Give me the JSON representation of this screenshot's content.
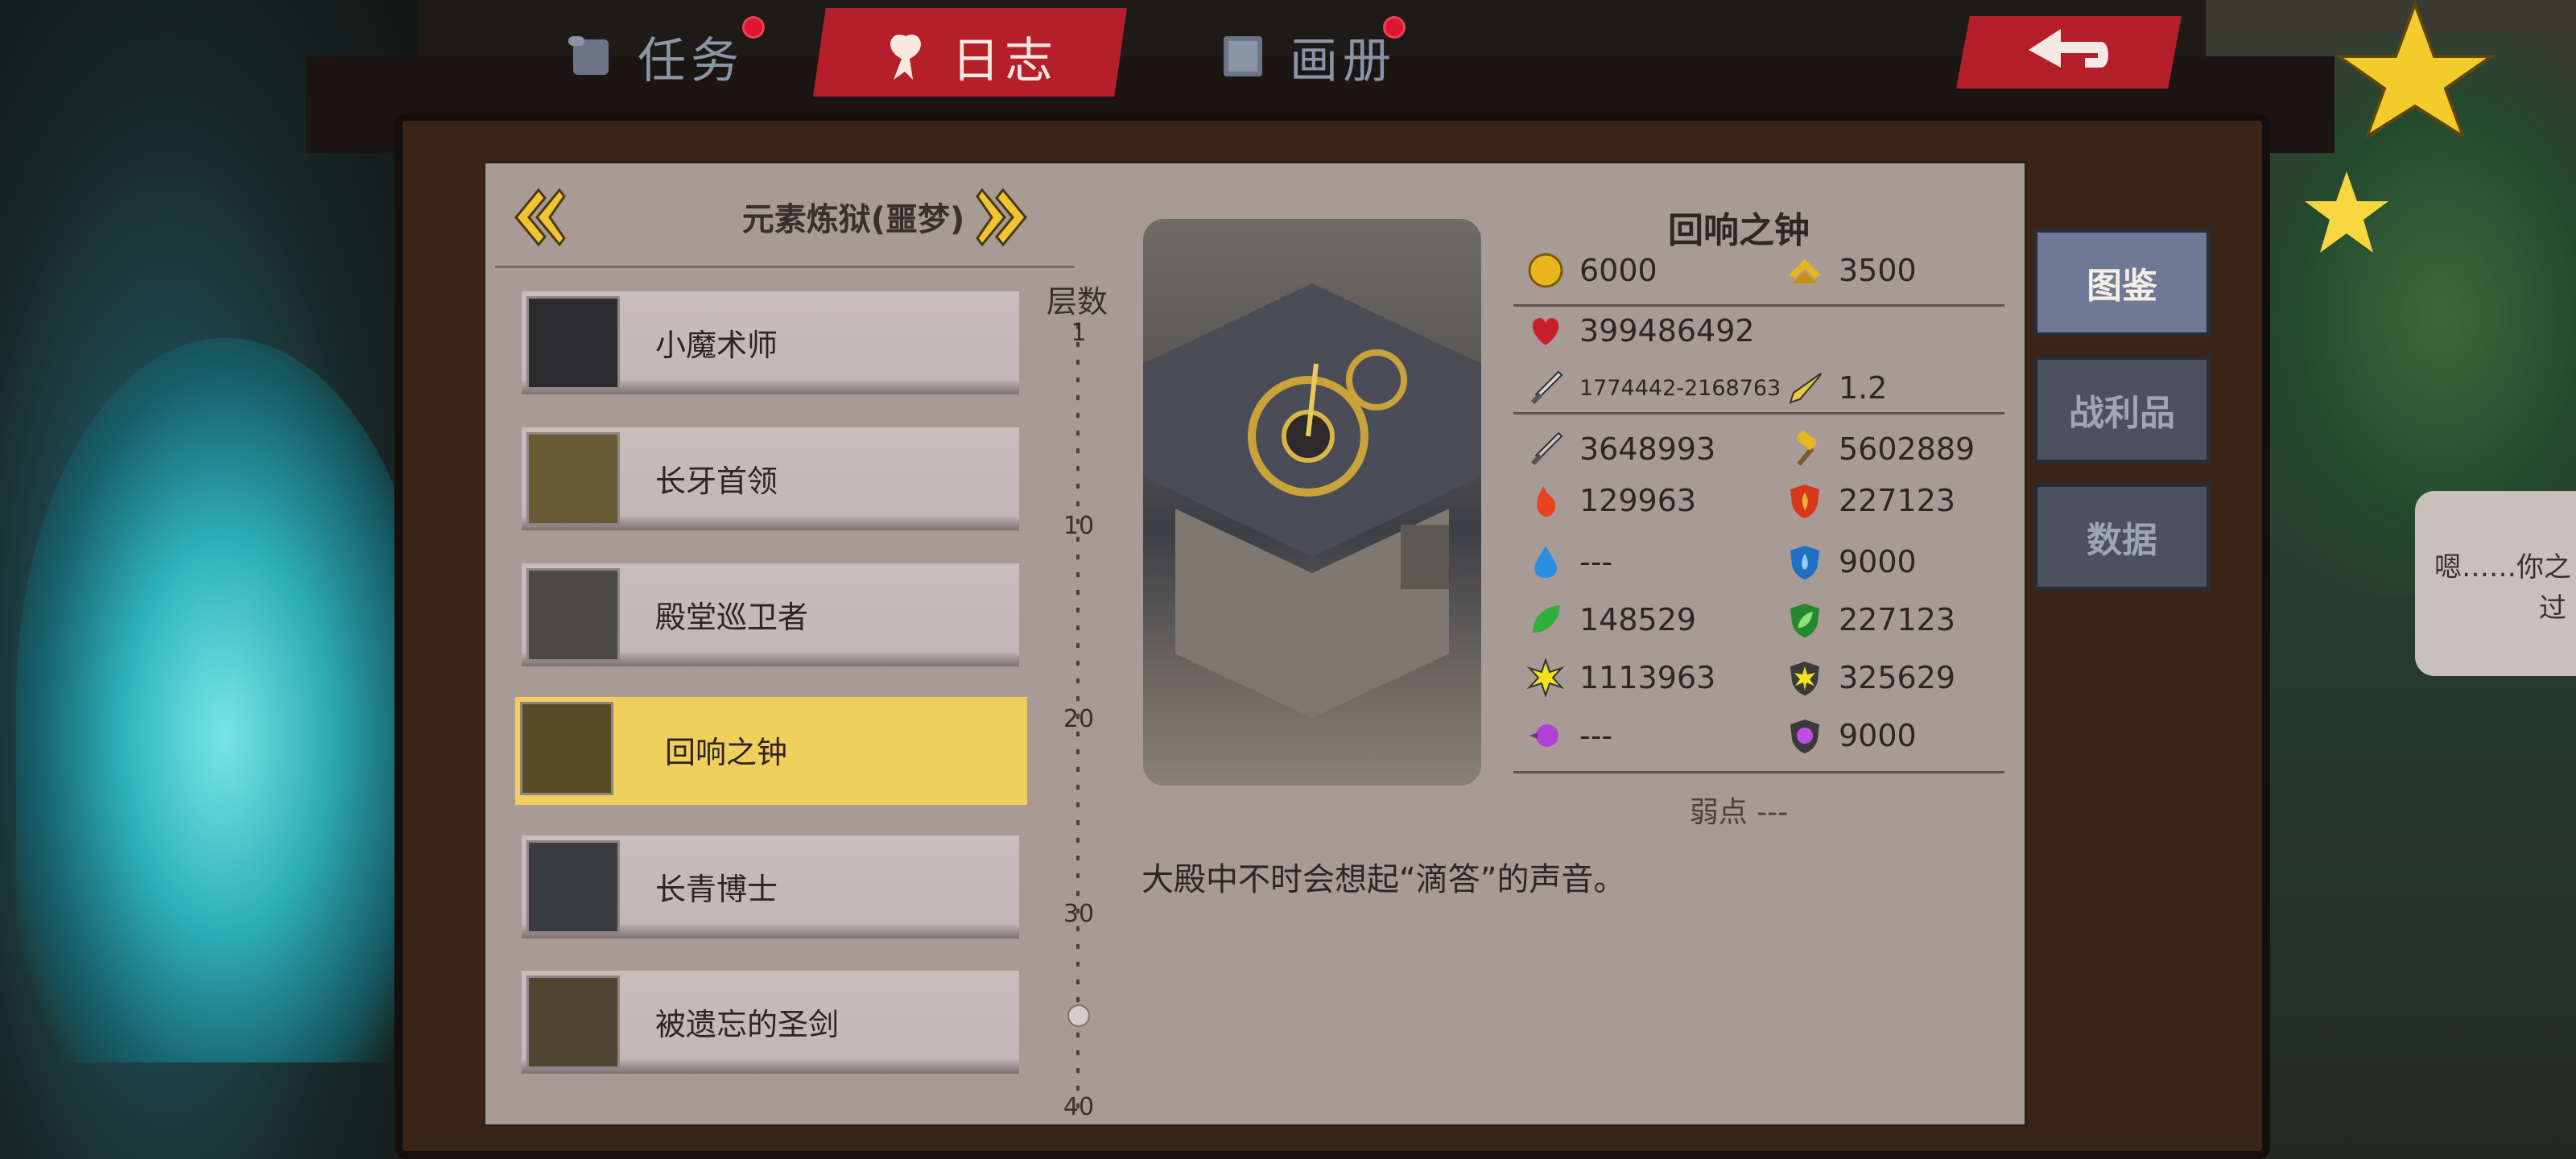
{
  "tabs": [
    {
      "label": "任务",
      "active": false
    },
    {
      "label": "日志",
      "active": true
    },
    {
      "label": "画册",
      "active": false
    }
  ],
  "dungeon": {
    "title": "元素炼狱(噩梦)"
  },
  "bosses": [
    {
      "name": "小魔术师",
      "active": false
    },
    {
      "name": "长牙首领",
      "active": false
    },
    {
      "name": "殿堂巡卫者",
      "active": false
    },
    {
      "name": "回响之钟",
      "active": true
    },
    {
      "name": "长青博士",
      "active": false
    },
    {
      "name": "被遗忘的圣剑",
      "active": false
    }
  ],
  "floors": {
    "label": "层数",
    "ticks": [
      "1",
      "10",
      "20",
      "30",
      "40"
    ]
  },
  "boss": {
    "name": "回响之钟",
    "gold": "6000",
    "exp": "3500",
    "hp": "399486492",
    "attack": "1774442-2168763",
    "attack_speed": "1.2",
    "phys_attack": "3648993",
    "phys_defense": "5602889",
    "fire_attack": "129963",
    "fire_defense": "227123",
    "water_attack": "---",
    "water_defense": "9000",
    "wind_attack": "148529",
    "wind_defense": "227123",
    "light_attack": "1113963",
    "light_defense": "325629",
    "dark_attack": "---",
    "dark_defense": "9000",
    "weakness": "弱点 ---",
    "description": "大殿中不时会想起“滴答”的声音。"
  },
  "side_tabs": [
    {
      "label": "图鉴",
      "active": true
    },
    {
      "label": "战利品",
      "active": false
    },
    {
      "label": "数据",
      "active": false
    }
  ],
  "npc_bubble": {
    "line1": "嗯……你之",
    "line2": "过"
  },
  "colors": {
    "active_tab": "#b41f2a",
    "selected_card": "#f0cf5c",
    "panel": "#a89b96"
  }
}
